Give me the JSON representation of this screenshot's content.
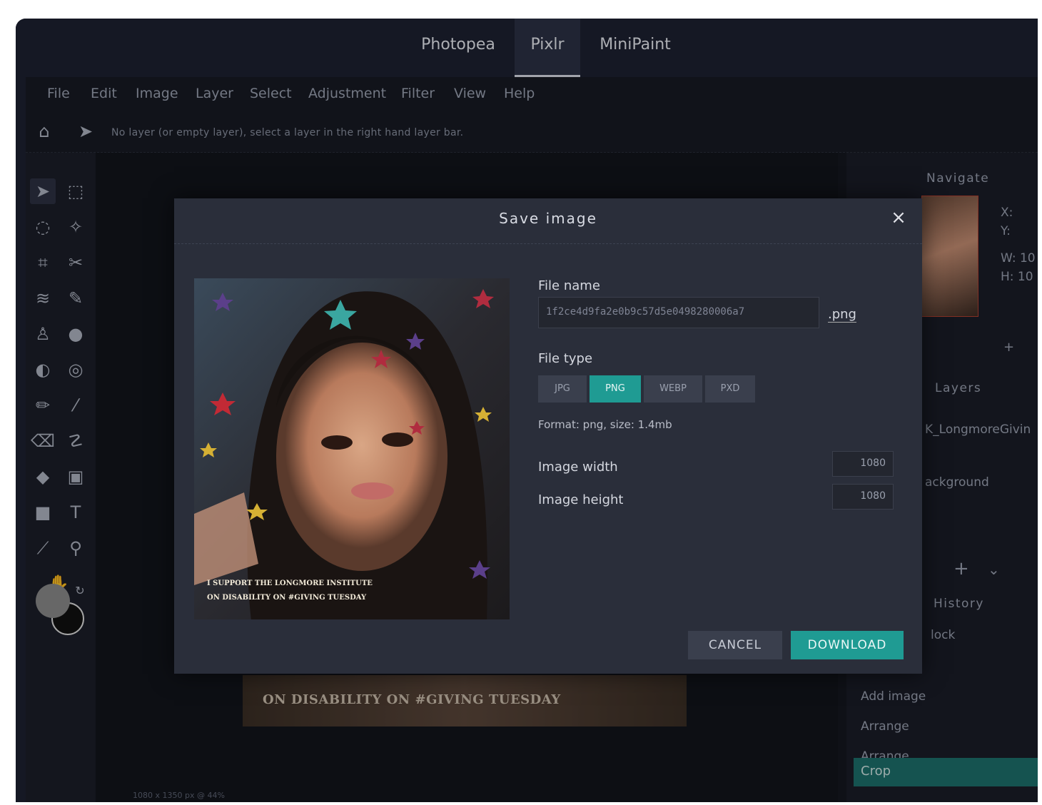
{
  "app_tabs": [
    "Photopea",
    "Pixlr",
    "MiniPaint"
  ],
  "menu": [
    "File",
    "Edit",
    "Image",
    "Layer",
    "Select",
    "Adjustment",
    "Filter",
    "View",
    "Help"
  ],
  "info_text": "No layer (or empty layer), select a layer in the right hand layer bar.",
  "status_text": "1080 x 1350 px @ 44%",
  "background_caption": "ON DISABILITY ON #GIVING TUESDAY",
  "right_panel": {
    "navigate_title": "Navigate",
    "nav_labels": {
      "x": "X:",
      "y": "Y:",
      "w": "W: 10",
      "h": "H: 10"
    },
    "layers_title": "Layers",
    "layers": [
      "K_LongmoreGivin",
      "ackground"
    ],
    "history_title": "History",
    "history": [
      "lock",
      "Add image",
      "Arrange",
      "Arrange",
      "Crop"
    ]
  },
  "modal": {
    "title": "Save image",
    "close": "×",
    "file_name_label": "File name",
    "file_name_value": "1f2ce4d9fa2e0b9c57d5e0498280006a7",
    "extension": ".png",
    "file_type_label": "File type",
    "file_types": [
      "JPG",
      "PNG",
      "WEBP",
      "PXD"
    ],
    "active_type": "PNG",
    "format_info": "Format: png, size: 1.4mb",
    "width_label": "Image width",
    "width_value": "1080",
    "height_label": "Image height",
    "height_value": "1080",
    "cancel": "CANCEL",
    "download": "DOWNLOAD",
    "preview_caption_1": "I SUPPORT THE LONGMORE INSTITUTE",
    "preview_caption_2": "ON DISABILITY ON #GIVING TUESDAY"
  },
  "colors": {
    "accent": "#1f9b93",
    "background": "#1d2130"
  }
}
